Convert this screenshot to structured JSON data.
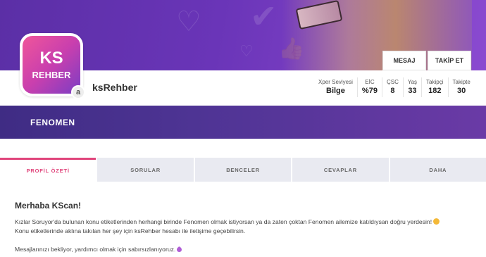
{
  "profile": {
    "avatar_line1": "KS",
    "avatar_line2": "REHBER",
    "badge": "a",
    "username": "ksRehber"
  },
  "actions": {
    "message_label": "MESAJ",
    "follow_label": "TAKİP ET"
  },
  "stats": [
    {
      "label": "Xper Seviyesi",
      "value": "Bilge"
    },
    {
      "label": "EİC",
      "value": "%79"
    },
    {
      "label": "ÇSC",
      "value": "8"
    },
    {
      "label": "Yaş",
      "value": "33"
    },
    {
      "label": "Takipçi",
      "value": "182"
    },
    {
      "label": "Takipte",
      "value": "30"
    }
  ],
  "category": "FENOMEN",
  "tabs": [
    {
      "label": "PROFİL ÖZETİ",
      "active": true
    },
    {
      "label": "SORULAR",
      "active": false
    },
    {
      "label": "BENCELER",
      "active": false
    },
    {
      "label": "CEVAPLAR",
      "active": false
    },
    {
      "label": "DAHA",
      "active": false
    }
  ],
  "about": {
    "heading": "Merhaba KScan!",
    "line1": "Kızlar Soruyor'da bulunan konu etiketlerinden herhangi birinde Fenomen olmak istiyorsan ya da zaten çoktan Fenomen ailemize katıldıysan doğru yerdesin!",
    "line2": "Konu etiketlerinde aklına takılan her şey için ksRehber hesabı ile iletişime geçebilirsin.",
    "line3": "Mesajlarınızı bekliyor, yardımcı olmak için sabırsızlanıyoruz."
  },
  "colors": {
    "accent_pink": "#e0457b",
    "banner_purple": "#6a35b8",
    "category_bar": "#4e3494"
  }
}
